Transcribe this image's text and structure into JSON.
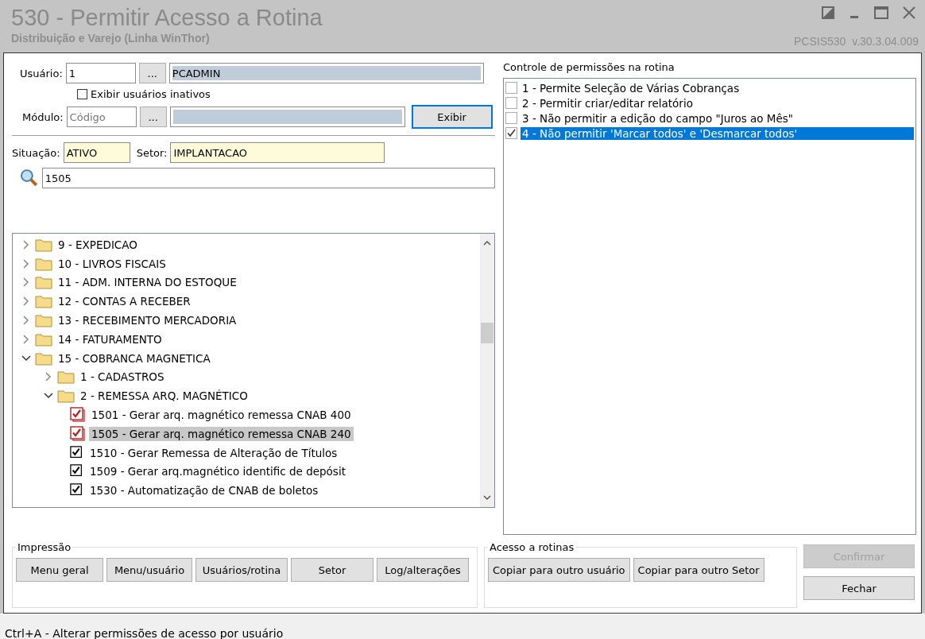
{
  "window": {
    "title": "530 - Permitir Acesso a Rotina",
    "subtitle": "Distribuição e Varejo (Linha WinThor)",
    "version": "PCSIS530  v.30.3.04.009"
  },
  "user": {
    "label": "Usuário:",
    "code": "1",
    "lookup": "...",
    "name": "PCADMIN"
  },
  "show_inactive": {
    "label": "Exibir usuários inativos",
    "checked": false
  },
  "module": {
    "label": "Módulo:",
    "placeholder": "Código",
    "lookup": "...",
    "button": "Exibir"
  },
  "situation": {
    "label": "Situação:",
    "value": "ATIVO"
  },
  "sector": {
    "label": "Setor:",
    "value": "IMPLANTACAO"
  },
  "search": {
    "value": "1505"
  },
  "tree": [
    {
      "kind": "folder",
      "label": "9 - EXPEDICAO",
      "expanded": false
    },
    {
      "kind": "folder",
      "label": "10 - LIVROS FISCAIS",
      "expanded": false
    },
    {
      "kind": "folder",
      "label": "11 - ADM. INTERNA DO ESTOQUE",
      "expanded": false
    },
    {
      "kind": "folder",
      "label": "12 - CONTAS A RECEBER",
      "expanded": false
    },
    {
      "kind": "folder",
      "label": "13 - RECEBIMENTO MERCADORIA",
      "expanded": false
    },
    {
      "kind": "folder",
      "label": "14 - FATURAMENTO",
      "expanded": false
    },
    {
      "kind": "folder",
      "label": "15 - COBRANCA MAGNETICA",
      "expanded": true,
      "children": [
        {
          "kind": "folder",
          "label": "1 - CADASTROS",
          "expanded": false
        },
        {
          "kind": "folder",
          "label": "2 - REMESSA ARQ. MAGNÉTICO",
          "expanded": true,
          "children": [
            {
              "kind": "routine",
              "label": "1501 - Gerar arq. magnético remessa CNAB 400",
              "checked": true,
              "changed": true,
              "selected": false
            },
            {
              "kind": "routine",
              "label": "1505 - Gerar arq. magnético remessa CNAB 240",
              "checked": true,
              "changed": true,
              "selected": true
            },
            {
              "kind": "routine",
              "label": "1510 - Gerar Remessa de Alteração de Títulos",
              "checked": true,
              "changed": false,
              "selected": false
            },
            {
              "kind": "routine",
              "label": "1509 - Gerar arq.magnético identific de depósit",
              "checked": true,
              "changed": false,
              "selected": false
            },
            {
              "kind": "routine",
              "label": "1530 - Automatização de CNAB de boletos",
              "checked": true,
              "changed": false,
              "selected": false
            }
          ]
        }
      ]
    }
  ],
  "permissions": {
    "title": "Controle de permissões na rotina",
    "items": [
      {
        "label": "1 - Permite Seleção de Várias Cobranças",
        "checked": false,
        "selected": false
      },
      {
        "label": "2 - Permitir criar/editar relatório",
        "checked": false,
        "selected": false
      },
      {
        "label": "3 - Não permitir a edição do campo \"Juros ao Mês\"",
        "checked": false,
        "selected": false
      },
      {
        "label": "4 - Não permitir 'Marcar todos' e 'Desmarcar todos'",
        "checked": true,
        "selected": true
      }
    ]
  },
  "print_group": {
    "title": "Impressão",
    "buttons": [
      "Menu geral",
      "Menu/usuário",
      "Usuários/rotina",
      "Setor",
      "Log/alterações"
    ]
  },
  "access_group": {
    "title": "Acesso a rotinas",
    "buttons": [
      "Copiar para outro usuário",
      "Copiar para outro Setor"
    ]
  },
  "actions": [
    {
      "label": "Confirmar",
      "disabled": true
    },
    {
      "label": "Fechar",
      "disabled": false
    }
  ],
  "status_bar": "Ctrl+A - Alterar permissões de acesso por usuário"
}
